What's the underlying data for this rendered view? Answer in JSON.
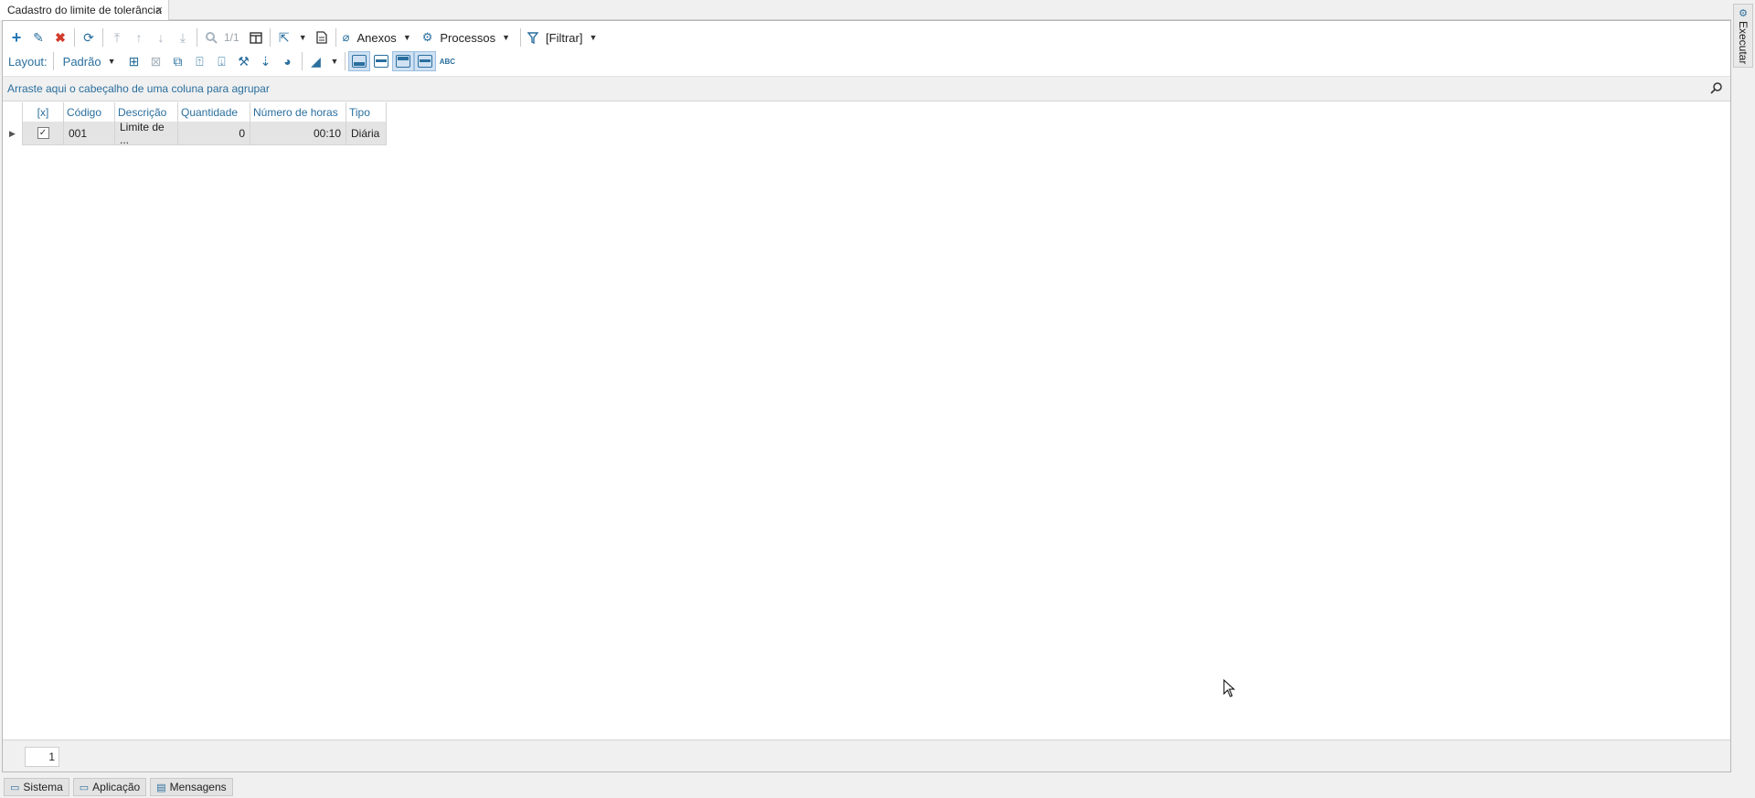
{
  "tab": {
    "title": "Cadastro do limite de tolerância",
    "close": "×"
  },
  "toolbar1": {
    "pager": "1/1",
    "anexos": "Anexos",
    "processos": "Processos",
    "filtrar": "[Filtrar]"
  },
  "toolbar2": {
    "layout_label": "Layout:",
    "layout_value": "Padrão",
    "abc": "ABC"
  },
  "group_hint": "Arraste aqui o cabeçalho de uma coluna para agrupar",
  "grid": {
    "headers": [
      "[x]",
      "Código",
      "Descrição",
      "Quantidade",
      "Número de horas",
      "Tipo"
    ],
    "rows": [
      {
        "checked": "✓",
        "codigo": "001",
        "descricao": "Limite de ...",
        "quantidade": "0",
        "horas": "00:10",
        "tipo": "Diária"
      }
    ]
  },
  "pager": {
    "page": "1"
  },
  "side_tab": {
    "label": "Executar"
  },
  "status_tabs": [
    "Sistema",
    "Aplicação",
    "Mensagens"
  ],
  "colors": {
    "accent": "#2a6f9e",
    "delete": "#d23b2b"
  }
}
